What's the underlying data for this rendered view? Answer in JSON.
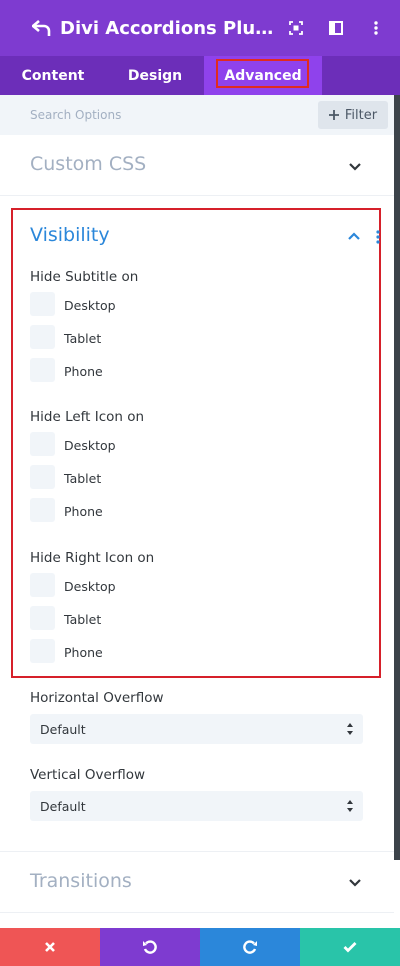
{
  "header": {
    "title": "Divi Accordions Plus Item Settings"
  },
  "tabs": [
    {
      "label": "Content"
    },
    {
      "label": "Design"
    },
    {
      "label": "Advanced"
    }
  ],
  "search": {
    "placeholder": "Search Options",
    "filter_label": "Filter"
  },
  "sections": {
    "custom_css": "Custom CSS",
    "visibility": "Visibility",
    "transitions": "Transitions"
  },
  "visibility": {
    "groups": [
      {
        "label": "Hide Subtitle on",
        "options": [
          "Desktop",
          "Tablet",
          "Phone"
        ]
      },
      {
        "label": "Hide Left Icon on",
        "options": [
          "Desktop",
          "Tablet",
          "Phone"
        ]
      },
      {
        "label": "Hide Right Icon on",
        "options": [
          "Desktop",
          "Tablet",
          "Phone"
        ]
      }
    ]
  },
  "overflow": {
    "horizontal_label": "Horizontal Overflow",
    "horizontal_value": "Default",
    "vertical_label": "Vertical Overflow",
    "vertical_value": "Default"
  },
  "icons": {
    "back": "undo-arrow-icon",
    "expand": "focus-expand-icon",
    "layout": "sidebar-layout-icon",
    "more": "more-vertical-icon",
    "cancel": "close-icon",
    "undo": "undo-icon",
    "redo": "redo-icon",
    "save": "check-icon"
  },
  "colors": {
    "header": "#7e3bd0",
    "tabs": "#6c2eb9",
    "active_tab": "#8f42ec",
    "accent_blue": "#2b87da",
    "highlight_red": "#d6202a",
    "cancel": "#ef5555",
    "undo": "#7e3bd0",
    "redo": "#2b87da",
    "save": "#29c4a9"
  }
}
